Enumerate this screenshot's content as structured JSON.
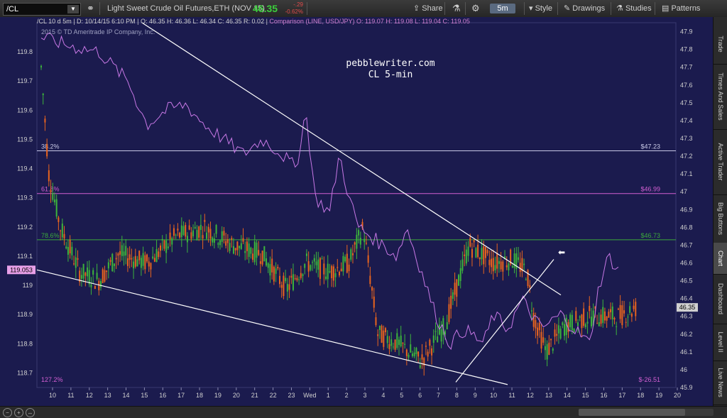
{
  "toolbar": {
    "symbol": "/CL",
    "description": "Light Sweet Crude Oil Futures,ETH (NOV 15)",
    "last_price": "46.35",
    "change": "-.29",
    "change_pct": "-0.62%",
    "share_label": "Share",
    "timeframe": "5m",
    "style_label": "Style",
    "drawings_label": "Drawings",
    "studies_label": "Studies",
    "patterns_label": "Patterns"
  },
  "info": {
    "header": "/CL 10 d 5m",
    "date": "D: 10/14/15 6:10 PM",
    "ohlc": "O: 46.35  H: 46.36  L: 46.34  C: 46.35  R: 0.02",
    "comparison": "Comparison (LINE, USD/JPY)  O: 119.07  H: 119.08  L: 119.04  C: 119.05",
    "copyright": "2015 © TD Ameritrade IP Company, Inc."
  },
  "watermark": {
    "line1": "pebblewriter.com",
    "line2": "CL 5-min"
  },
  "chart_data": {
    "type": "candlestick",
    "primary": {
      "symbol": "/CL",
      "axis": "right",
      "ylim": [
        45.9,
        47.95
      ],
      "last": 46.35
    },
    "comparison": {
      "symbol": "USD/JPY",
      "axis": "left",
      "ylim": [
        118.65,
        119.9
      ],
      "last": 119.053
    },
    "left_ticks": [
      "119.8",
      "119.7",
      "119.6",
      "119.5",
      "119.4",
      "119.3",
      "119.2",
      "119.1",
      "119",
      "118.9",
      "118.8",
      "118.7"
    ],
    "left_values": [
      119.8,
      119.7,
      119.6,
      119.5,
      119.4,
      119.3,
      119.2,
      119.1,
      119.0,
      118.9,
      118.8,
      118.7
    ],
    "right_ticks": [
      "47.9",
      "47.8",
      "47.7",
      "47.6",
      "47.5",
      "47.4",
      "47.3",
      "47.2",
      "47.1",
      "47",
      "46.9",
      "46.8",
      "46.7",
      "46.6",
      "46.5",
      "46.4",
      "46.3",
      "46.2",
      "46.1",
      "46",
      "45.9"
    ],
    "right_values": [
      47.9,
      47.8,
      47.7,
      47.6,
      47.5,
      47.4,
      47.3,
      47.2,
      47.1,
      47.0,
      46.9,
      46.8,
      46.7,
      46.6,
      46.5,
      46.4,
      46.3,
      46.2,
      46.1,
      46.0,
      45.9
    ],
    "x_ticks": [
      "10",
      "11",
      "12",
      "13",
      "14",
      "15",
      "16",
      "17",
      "18",
      "19",
      "20",
      "21",
      "22",
      "23",
      "Wed",
      "1",
      "2",
      "3",
      "4",
      "5",
      "6",
      "7",
      "8",
      "9",
      "10",
      "11",
      "12",
      "13",
      "14",
      "15",
      "16",
      "17",
      "18",
      "19",
      "20"
    ],
    "fib_levels": [
      {
        "label": "38.2%",
        "value": 47.23,
        "value_label": "$47.23",
        "color": "#c8c8e6"
      },
      {
        "label": "61.8%",
        "value": 46.99,
        "value_label": "$46.99",
        "color": "#d25fd2"
      },
      {
        "label": "78.6%",
        "value": 46.73,
        "value_label": "$46.73",
        "color": "#3caa3c"
      },
      {
        "label": "127.2%",
        "value": 45.92,
        "value_label": "$-26.51",
        "color": "#d25fd2"
      }
    ],
    "last_price_tag": "46.35",
    "comparison_tag": "119.053",
    "colors": {
      "up": "#3cb43c",
      "down": "#e8641e",
      "comparison": "#c878e6",
      "trendline": "#ffffff",
      "background": "#1b1b4e"
    }
  },
  "right_tabs": [
    "Trade",
    "Times And Sales",
    "Active Trader",
    "Big Buttons",
    "Chart",
    "Dashboard",
    "Level II",
    "Live News"
  ],
  "active_tab": "Chart"
}
